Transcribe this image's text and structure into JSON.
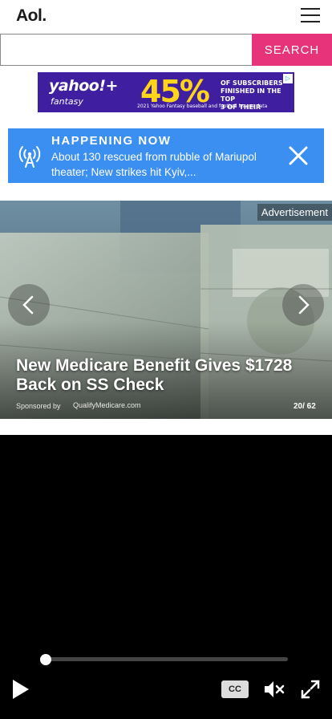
{
  "header": {
    "logo_text": "Aol.",
    "menu_icon": "hamburger-menu-icon"
  },
  "search": {
    "value": "",
    "placeholder": "",
    "button_label": "SEARCH",
    "accent_color": "#e6337a"
  },
  "ad_banner": {
    "brand": "yahoo!+",
    "brand_sub": "fantasy",
    "headline": "45%",
    "lines": [
      "OF SUBSCRIBERS",
      "FINISHED IN THE TOP",
      "3 OF THEIR LEAGUES"
    ],
    "footnote": "2021 Yahoo Fantasy baseball and football league data",
    "adchoices_icon": "adchoices-icon",
    "background_color": "#3f1fa0"
  },
  "happening_now": {
    "title": "HAPPENING NOW",
    "text": "About 130 rescued from rubble of Mariupol theater; New strikes hit Kyiv,...",
    "icon": "broadcast-antenna-icon",
    "close_icon": "close-icon",
    "background_color": "#3b8ff0"
  },
  "slideshow": {
    "ad_label": "Advertisement",
    "title": "New Medicare Benefit Gives $1728 Back on SS Check",
    "sponsored_label": "Sponsored by",
    "sponsor": "QualifyMedicare.com",
    "counter": "20/ 62",
    "prev_icon": "chevron-left-icon",
    "next_icon": "chevron-right-icon"
  },
  "video_player": {
    "progress": 0,
    "play_icon": "play-icon",
    "cc_label": "CC",
    "mute_icon": "muted-speaker-icon",
    "fullscreen_icon": "fullscreen-icon"
  }
}
